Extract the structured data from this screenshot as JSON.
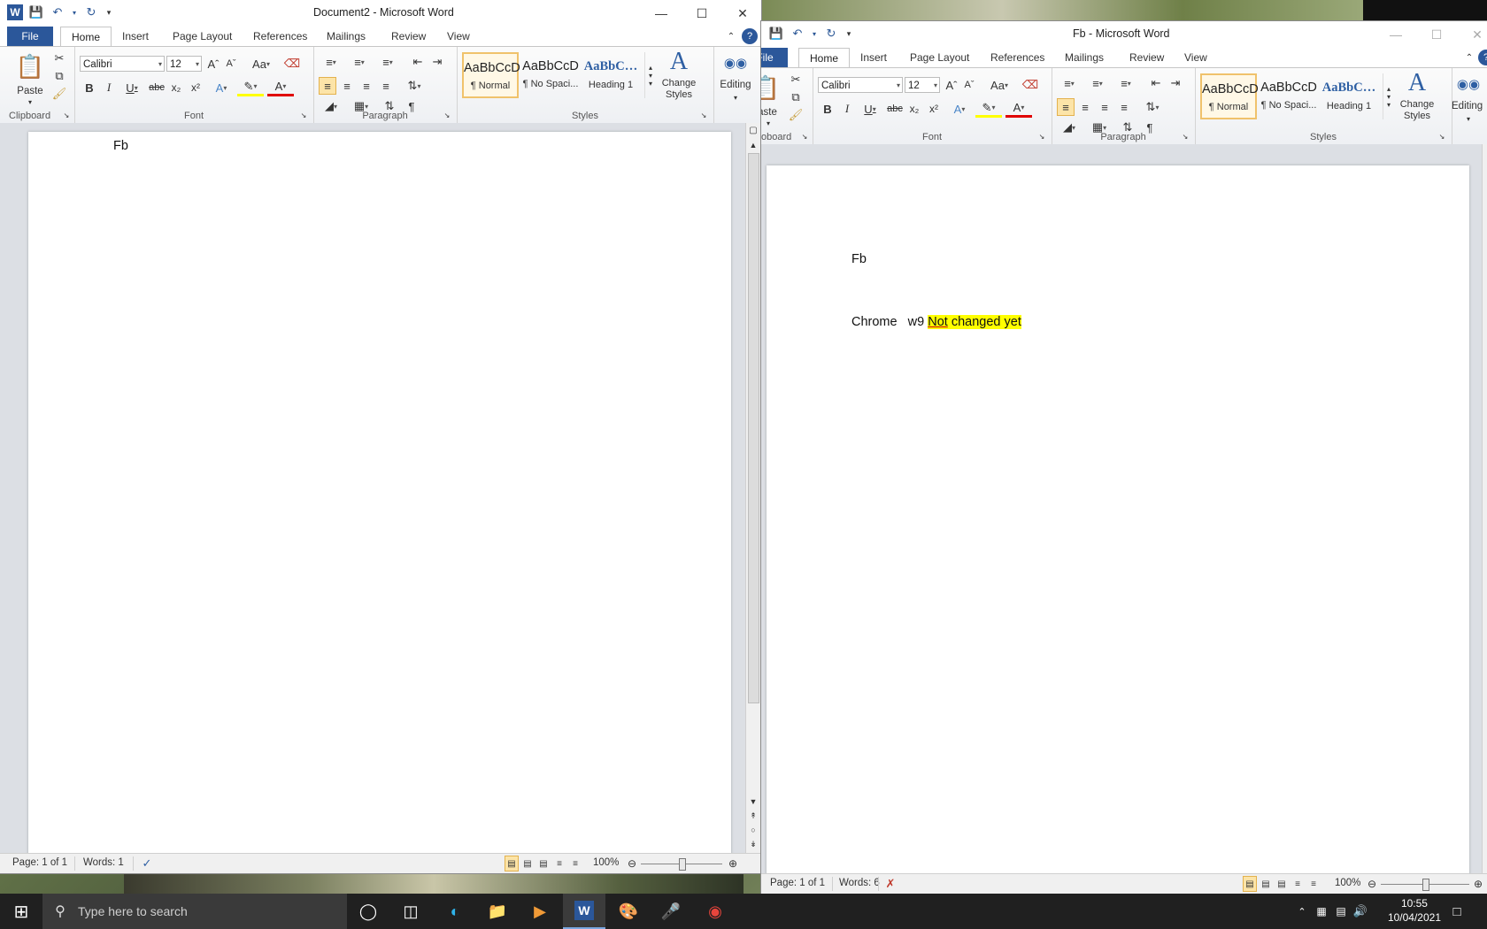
{
  "win1": {
    "title": "Document2  -  Microsoft Word",
    "tabs": {
      "file": "File",
      "home": "Home",
      "insert": "Insert",
      "page_layout": "Page Layout",
      "references": "References",
      "mailings": "Mailings",
      "review": "Review",
      "view": "View"
    },
    "font_name": "Calibri",
    "font_size": "12",
    "groups": {
      "clipboard": "Clipboard",
      "font": "Font",
      "paragraph": "Paragraph",
      "styles": "Styles"
    },
    "paste_label": "Paste",
    "styles": [
      {
        "preview": "AaBbCcD",
        "name": "¶ Normal"
      },
      {
        "preview": "AaBbCcD",
        "name": "¶ No Spaci..."
      },
      {
        "preview": "AaBbC…",
        "name": "Heading 1"
      }
    ],
    "change_styles": "Change Styles",
    "editing": "Editing",
    "doc_line1": "Fb",
    "status": {
      "page": "Page: 1 of 1",
      "words": "Words: 1",
      "zoom": "100%"
    }
  },
  "win2": {
    "title": "Fb  -  Microsoft Word",
    "tabs": {
      "file": "File",
      "home": "Home",
      "insert": "Insert",
      "page_layout": "Page Layout",
      "references": "References",
      "mailings": "Mailings",
      "review": "Review",
      "view": "View"
    },
    "font_name": "Calibri",
    "font_size": "12",
    "groups": {
      "clipboard": "oboard",
      "font": "Font",
      "paragraph": "Paragraph",
      "styles": "Styles"
    },
    "paste_label": "aste",
    "styles": [
      {
        "preview": "AaBbCcD",
        "name": "¶ Normal"
      },
      {
        "preview": "AaBbCcD",
        "name": "¶ No Spaci..."
      },
      {
        "preview": "AaBbC…",
        "name": "Heading 1"
      }
    ],
    "change_styles": "Change Styles",
    "editing": "Editing",
    "doc_line1": "Fb",
    "doc_line2_plain": "Chrome   w9 ",
    "doc_line2_highlight_a": "Not",
    "doc_line2_highlight_b": " changed yet",
    "status": {
      "page": "Page: 1 of 1",
      "words": "Words: 6",
      "zoom": "100%"
    }
  },
  "taskbar": {
    "search_placeholder": "Type here to search",
    "time": "10:55",
    "date": "10/04/2021"
  },
  "colors": {
    "word_blue": "#2b579a",
    "highlight": "#ffff00",
    "taskbar": "#202020"
  }
}
